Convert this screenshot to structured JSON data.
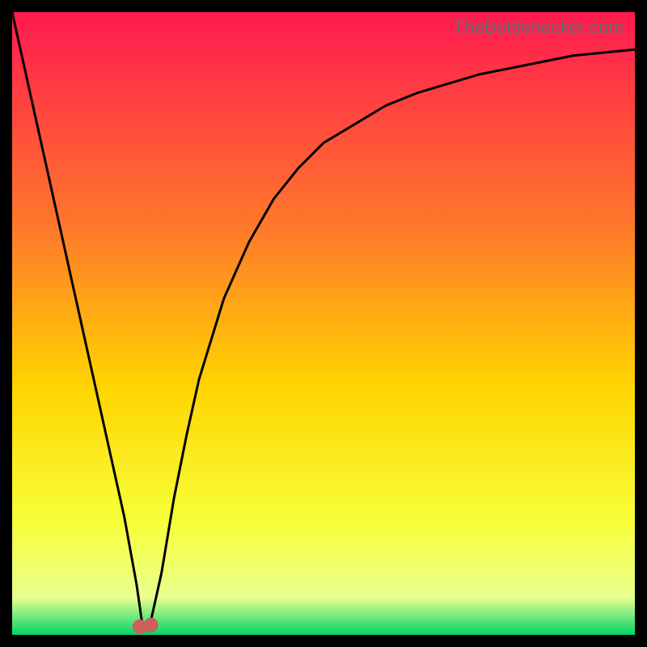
{
  "watermark": "TheBottlenecker.com",
  "colors": {
    "frame_bg": "#000000",
    "grad_top": "#ff1a50",
    "grad_mid_upper": "#ff7a2a",
    "grad_mid": "#ffd400",
    "grad_lower": "#f7ff3a",
    "grad_pale": "#eaff90",
    "grad_green": "#00d46a",
    "curve_stroke": "#000000",
    "marker_fill": "#c9605b"
  },
  "chart_data": {
    "type": "line",
    "title": "",
    "xlabel": "",
    "ylabel": "",
    "xlim": [
      0,
      100
    ],
    "ylim": [
      0,
      100
    ],
    "x_position_percent": [
      0,
      2,
      4,
      6,
      8,
      10,
      12,
      14,
      16,
      18,
      20,
      21,
      22,
      24,
      26,
      28,
      30,
      34,
      38,
      42,
      46,
      50,
      55,
      60,
      65,
      70,
      75,
      80,
      85,
      90,
      95,
      100
    ],
    "bottleneck_percent": [
      100,
      91,
      82,
      73,
      64,
      55,
      46,
      37,
      28,
      19,
      8,
      1,
      1,
      10,
      22,
      32,
      41,
      54,
      63,
      70,
      75,
      79,
      82,
      85,
      87,
      88.5,
      90,
      91,
      92,
      93,
      93.5,
      94
    ],
    "minimum_markers_x_percent": [
      20.5,
      22.3
    ],
    "minimum_markers_y_percent": [
      1.3,
      1.6
    ],
    "gradient_stops": [
      {
        "offset": 0.0,
        "key": "grad_top"
      },
      {
        "offset": 0.35,
        "key": "grad_mid_upper"
      },
      {
        "offset": 0.6,
        "key": "grad_mid"
      },
      {
        "offset": 0.82,
        "key": "grad_lower"
      },
      {
        "offset": 0.94,
        "key": "grad_pale"
      },
      {
        "offset": 1.0,
        "key": "grad_green"
      }
    ]
  }
}
